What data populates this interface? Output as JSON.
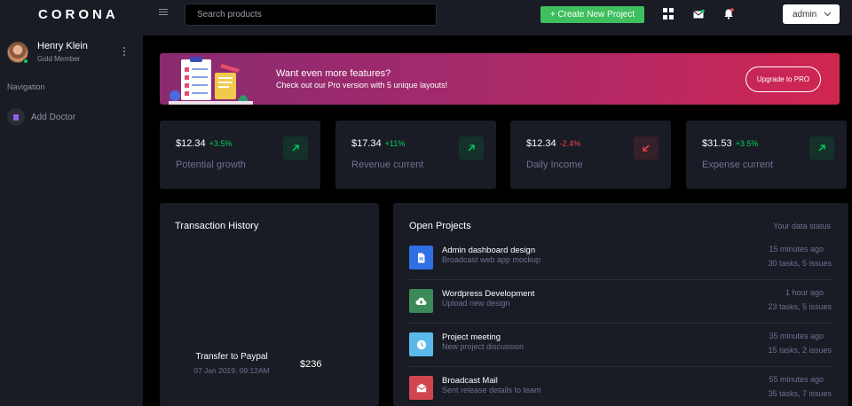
{
  "header": {
    "brand": "CORONA",
    "search_placeholder": "Search products",
    "create_label": "+ Create New Project",
    "user_menu_label": "admin"
  },
  "sidebar": {
    "user_name": "Henry Klein",
    "user_role": "Gold Member",
    "nav_caption": "Navigation",
    "items": [
      {
        "label": "Add Doctor",
        "icon": "document-icon"
      }
    ]
  },
  "banner": {
    "title": "Want even more features?",
    "subtitle": "Check out our Pro version with 5 unique layouts!",
    "button_label": "Upgrade to PRO"
  },
  "stats": [
    {
      "value": "$12.34",
      "change": "+3.5%",
      "trend": "up",
      "label": "Potential growth"
    },
    {
      "value": "$17.34",
      "change": "+11%",
      "trend": "up",
      "label": "Revenue current"
    },
    {
      "value": "$12.34",
      "change": "-2.4%",
      "trend": "down",
      "label": "Daily Income"
    },
    {
      "value": "$31.53",
      "change": "+3.5%",
      "trend": "up",
      "label": "Expense current"
    }
  ],
  "transactions": {
    "title": "Transaction History",
    "items": [
      {
        "name": "Transfer to Paypal",
        "date": "07 Jan 2019, 09:12AM",
        "amount": "$236"
      }
    ]
  },
  "projects": {
    "title": "Open Projects",
    "status_label": "Your data status",
    "items": [
      {
        "name": "Admin dashboard design",
        "desc": "Broadcast web app mockup",
        "time": "15 minutes ago",
        "tasks": "30 tasks, 5 issues",
        "icon": "file-icon",
        "color": "#2f6fe4"
      },
      {
        "name": "Wordpress Development",
        "desc": "Upload new design",
        "time": "1 hour ago",
        "tasks": "23 tasks, 5 issues",
        "icon": "cloud-download-icon",
        "color": "#3b8a57"
      },
      {
        "name": "Project meeting",
        "desc": "New project discussion",
        "time": "35 minutes ago",
        "tasks": "15 tasks, 2 issues",
        "icon": "clock-icon",
        "color": "#5ab9e8"
      },
      {
        "name": "Broadcast Mail",
        "desc": "Sent release details to team",
        "time": "55 minutes ago",
        "tasks": "35 tasks, 7 issues",
        "icon": "mail-icon",
        "color": "#d2454e"
      }
    ]
  },
  "colors": {
    "background": "#000000",
    "panel": "#191c24",
    "success": "#00d25b",
    "danger": "#fc424a",
    "muted": "#6c7293"
  }
}
